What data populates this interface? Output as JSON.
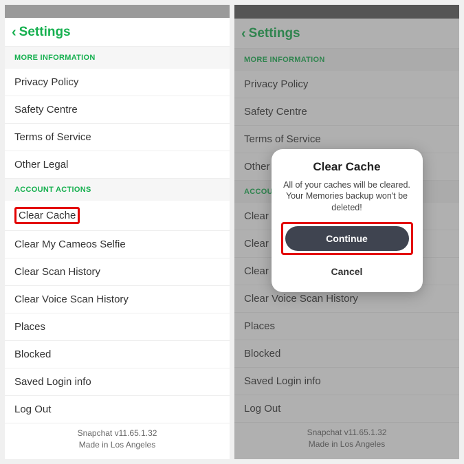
{
  "header": {
    "title": "Settings"
  },
  "sections": {
    "more_info": {
      "header": "MORE INFORMATION"
    },
    "account_actions": {
      "header": "ACCOUNT ACTIONS"
    }
  },
  "rows": {
    "privacy": "Privacy Policy",
    "safety": "Safety Centre",
    "tos": "Terms of Service",
    "legal": "Other Legal",
    "clear_cache": "Clear Cache",
    "clear_cameos": "Clear My Cameos Selfie",
    "clear_scan": "Clear Scan History",
    "clear_voice": "Clear Voice Scan History",
    "places": "Places",
    "blocked": "Blocked",
    "saved_login": "Saved Login info",
    "logout": "Log Out"
  },
  "footer": {
    "version": "Snapchat v11.65.1.32",
    "made_in": "Made in Los Angeles"
  },
  "modal": {
    "title": "Clear Cache",
    "body": "All of your caches will be cleared. Your Memories backup won't be deleted!",
    "continue": "Continue",
    "cancel": "Cancel"
  }
}
